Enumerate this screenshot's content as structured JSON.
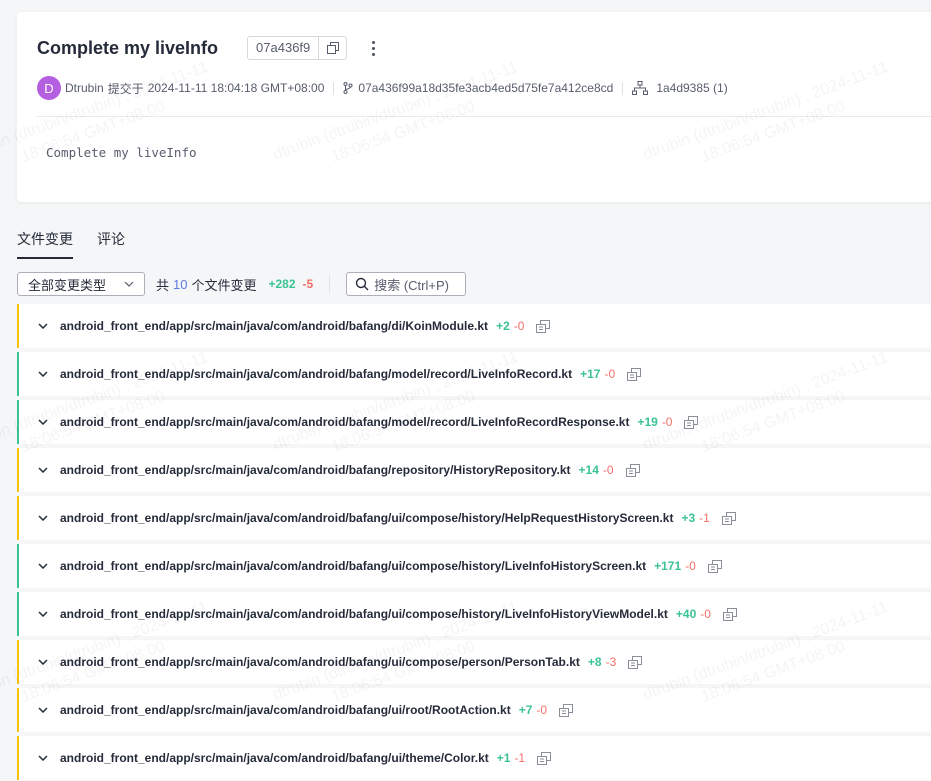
{
  "commit": {
    "title": "Complete my liveInfo",
    "short_hash": "07a436f9",
    "author_initial": "D",
    "author": "Dtrubin",
    "committed_label": "提交于",
    "date": "2024-11-11 18:04:18 GMT+08:00",
    "full_hash": "07a436f99a18d35fe3acb4ed5d75fe7a412ce8cd",
    "parent": "1a4d9385 (1)",
    "message": "Complete my liveInfo"
  },
  "tabs": [
    {
      "label": "文件变更"
    },
    {
      "label": "评论"
    }
  ],
  "toolbar": {
    "filter_label": "全部变更类型",
    "summary_prefix": "共",
    "file_count": "10",
    "summary_suffix": "个文件变更",
    "total_add": "+282",
    "total_del": "-5",
    "search_placeholder": "搜索 (Ctrl+P)"
  },
  "files": [
    {
      "path": "android_front_end/app/src/main/java/com/android/bafang/di/KoinModule.kt",
      "add": "+2",
      "del": "-0",
      "status": "mod"
    },
    {
      "path": "android_front_end/app/src/main/java/com/android/bafang/model/record/LiveInfoRecord.kt",
      "add": "+17",
      "del": "-0",
      "status": "new"
    },
    {
      "path": "android_front_end/app/src/main/java/com/android/bafang/model/record/LiveInfoRecordResponse.kt",
      "add": "+19",
      "del": "-0",
      "status": "new"
    },
    {
      "path": "android_front_end/app/src/main/java/com/android/bafang/repository/HistoryRepository.kt",
      "add": "+14",
      "del": "-0",
      "status": "mod"
    },
    {
      "path": "android_front_end/app/src/main/java/com/android/bafang/ui/compose/history/HelpRequestHistoryScreen.kt",
      "add": "+3",
      "del": "-1",
      "status": "mod"
    },
    {
      "path": "android_front_end/app/src/main/java/com/android/bafang/ui/compose/history/LiveInfoHistoryScreen.kt",
      "add": "+171",
      "del": "-0",
      "status": "new"
    },
    {
      "path": "android_front_end/app/src/main/java/com/android/bafang/ui/compose/history/LiveInfoHistoryViewModel.kt",
      "add": "+40",
      "del": "-0",
      "status": "new"
    },
    {
      "path": "android_front_end/app/src/main/java/com/android/bafang/ui/compose/person/PersonTab.kt",
      "add": "+8",
      "del": "-3",
      "status": "mod"
    },
    {
      "path": "android_front_end/app/src/main/java/com/android/bafang/ui/root/RootAction.kt",
      "add": "+7",
      "del": "-0",
      "status": "mod"
    },
    {
      "path": "android_front_end/app/src/main/java/com/android/bafang/ui/theme/Color.kt",
      "add": "+1",
      "del": "-1",
      "status": "mod"
    }
  ],
  "colors": {
    "added": "#3ac295",
    "deleted": "#f66f6a",
    "modified_bar": "#fac20a",
    "new_bar": "#3ac295",
    "accent": "#5e7ce0",
    "avatar": "#b45ee0"
  },
  "icons": [
    "copy-icon",
    "more-vertical-icon",
    "branch-icon",
    "tree-icon",
    "chevron-down-icon",
    "search-icon"
  ],
  "watermark": {
    "line1": "dtrubin (dtrubin/dtrubin) , 2024-11-11",
    "line2": "18:06:54 GMT+08:00"
  }
}
